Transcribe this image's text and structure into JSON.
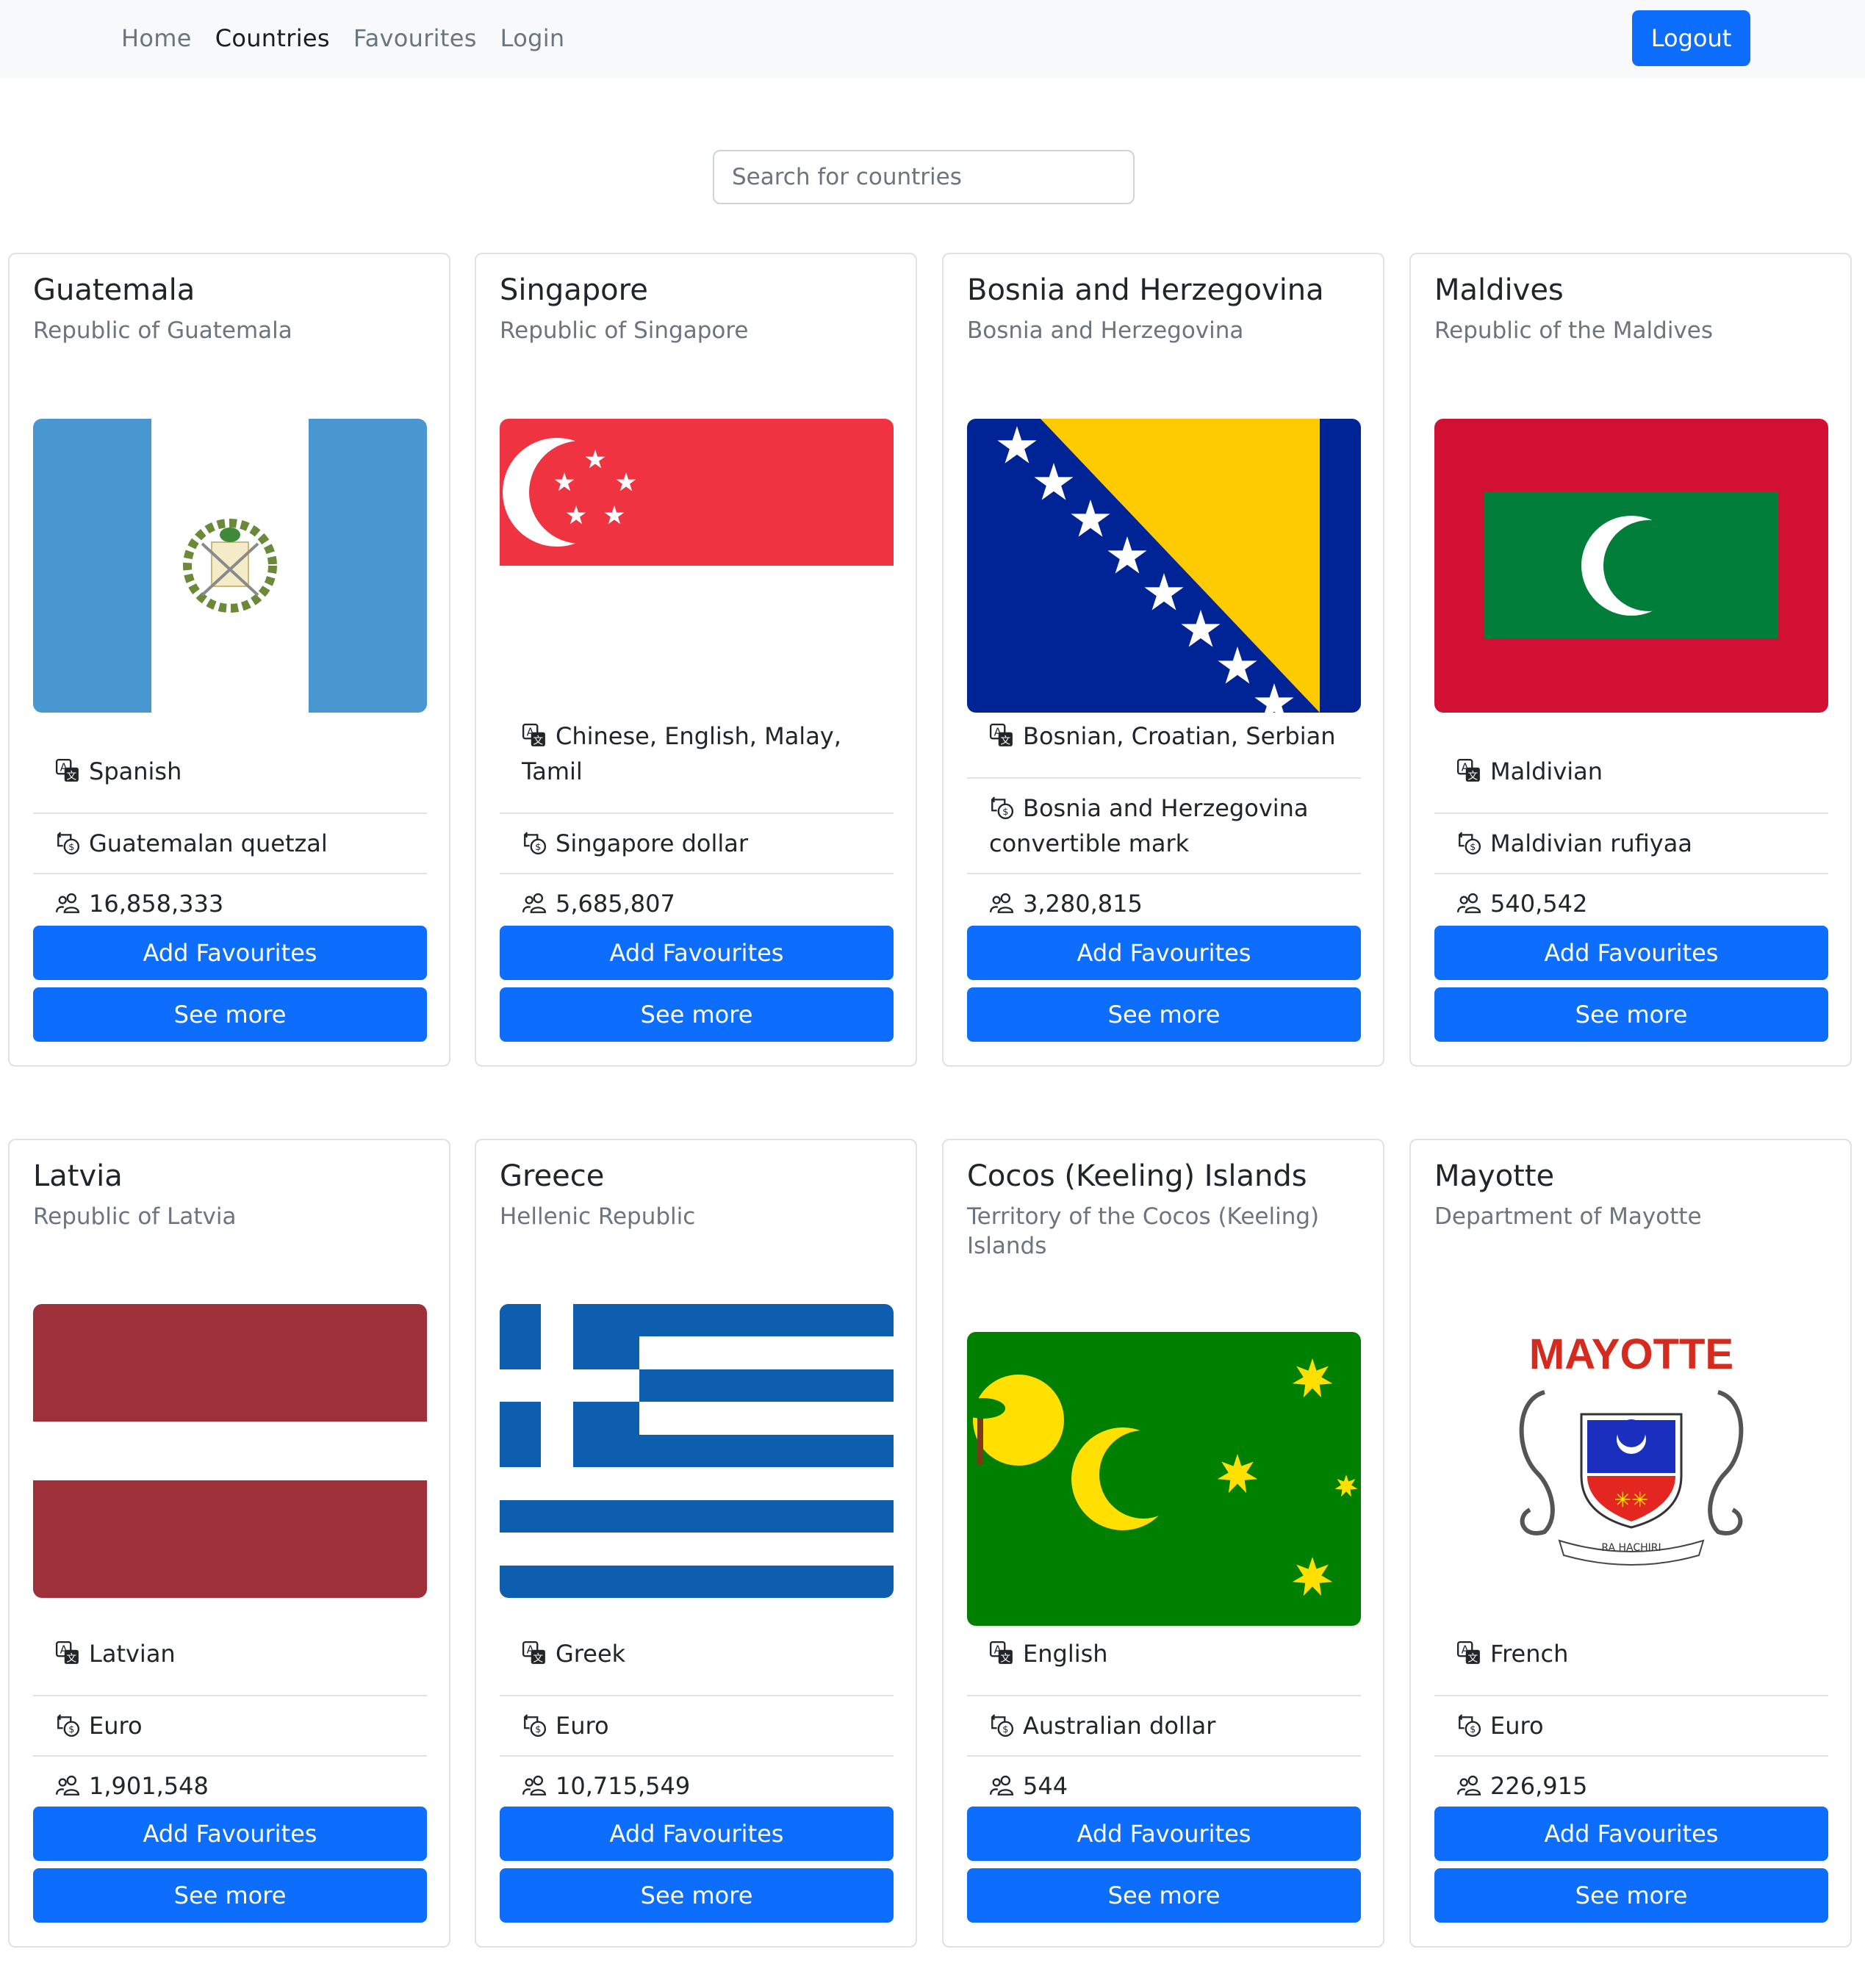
{
  "nav": {
    "links": [
      "Home",
      "Countries",
      "Favourites",
      "Login"
    ],
    "active": "Countries",
    "logout_label": "Logout"
  },
  "search": {
    "placeholder": "Search for countries",
    "value": ""
  },
  "buttons": {
    "add": "Add Favourites",
    "more": "See more"
  },
  "icons": {
    "language": "translate-icon",
    "currency": "currency-exchange-icon",
    "population": "people-icon"
  },
  "colors": {
    "primary": "#0d6efd",
    "navbar_bg": "#f8f9fa"
  },
  "cards": [
    {
      "name": "Guatemala",
      "official": "Republic of Guatemala",
      "languages": "Spanish",
      "currency": "Guatemalan quetzal",
      "population": "16,858,333"
    },
    {
      "name": "Singapore",
      "official": "Republic of Singapore",
      "languages": "Chinese, English, Malay, Tamil",
      "currency": "Singapore dollar",
      "population": "5,685,807"
    },
    {
      "name": "Bosnia and Herzegovina",
      "official": "Bosnia and Herzegovina",
      "languages": "Bosnian, Croatian, Serbian",
      "currency": "Bosnia and Herzegovina convertible mark",
      "population": "3,280,815"
    },
    {
      "name": "Maldives",
      "official": "Republic of the Maldives",
      "languages": "Maldivian",
      "currency": "Maldivian rufiyaa",
      "population": "540,542"
    },
    {
      "name": "Latvia",
      "official": "Republic of Latvia",
      "languages": "Latvian",
      "currency": "Euro",
      "population": "1,901,548"
    },
    {
      "name": "Greece",
      "official": "Hellenic Republic",
      "languages": "Greek",
      "currency": "Euro",
      "population": "10,715,549"
    },
    {
      "name": "Cocos (Keeling) Islands",
      "official": "Territory of the Cocos (Keeling) Islands",
      "languages": "English",
      "currency": "Australian dollar",
      "population": "544"
    },
    {
      "name": "Mayotte",
      "official": "Department of Mayotte",
      "languages": "French",
      "currency": "Euro",
      "population": "226,915",
      "flag_text": [
        "MAYOTTE",
        "RA HACHIRI"
      ]
    }
  ]
}
